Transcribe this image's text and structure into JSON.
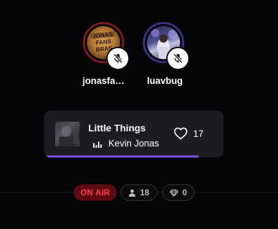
{
  "speakers": [
    {
      "name": "jonasfa…",
      "avatar_caption": "JONAS FANS BRASIL",
      "muted": true,
      "ring_color": "#7c1a22"
    },
    {
      "name": "luavbug",
      "muted": true,
      "ring_color": "#3b2f86"
    }
  ],
  "now_playing": {
    "title": "Little Things",
    "artist": "Kevin Jonas",
    "likes": "17",
    "progress": 0.86
  },
  "status": {
    "live_label": "ON AIR",
    "listeners": "18",
    "gems": "0"
  },
  "colors": {
    "accent": "#7b4fe0",
    "live_red": "#ff3b46"
  },
  "icons": {
    "mute": "mic-off-icon",
    "like": "heart-icon",
    "listeners": "person-icon",
    "gems": "diamond-icon",
    "playing": "equalizer-icon"
  }
}
